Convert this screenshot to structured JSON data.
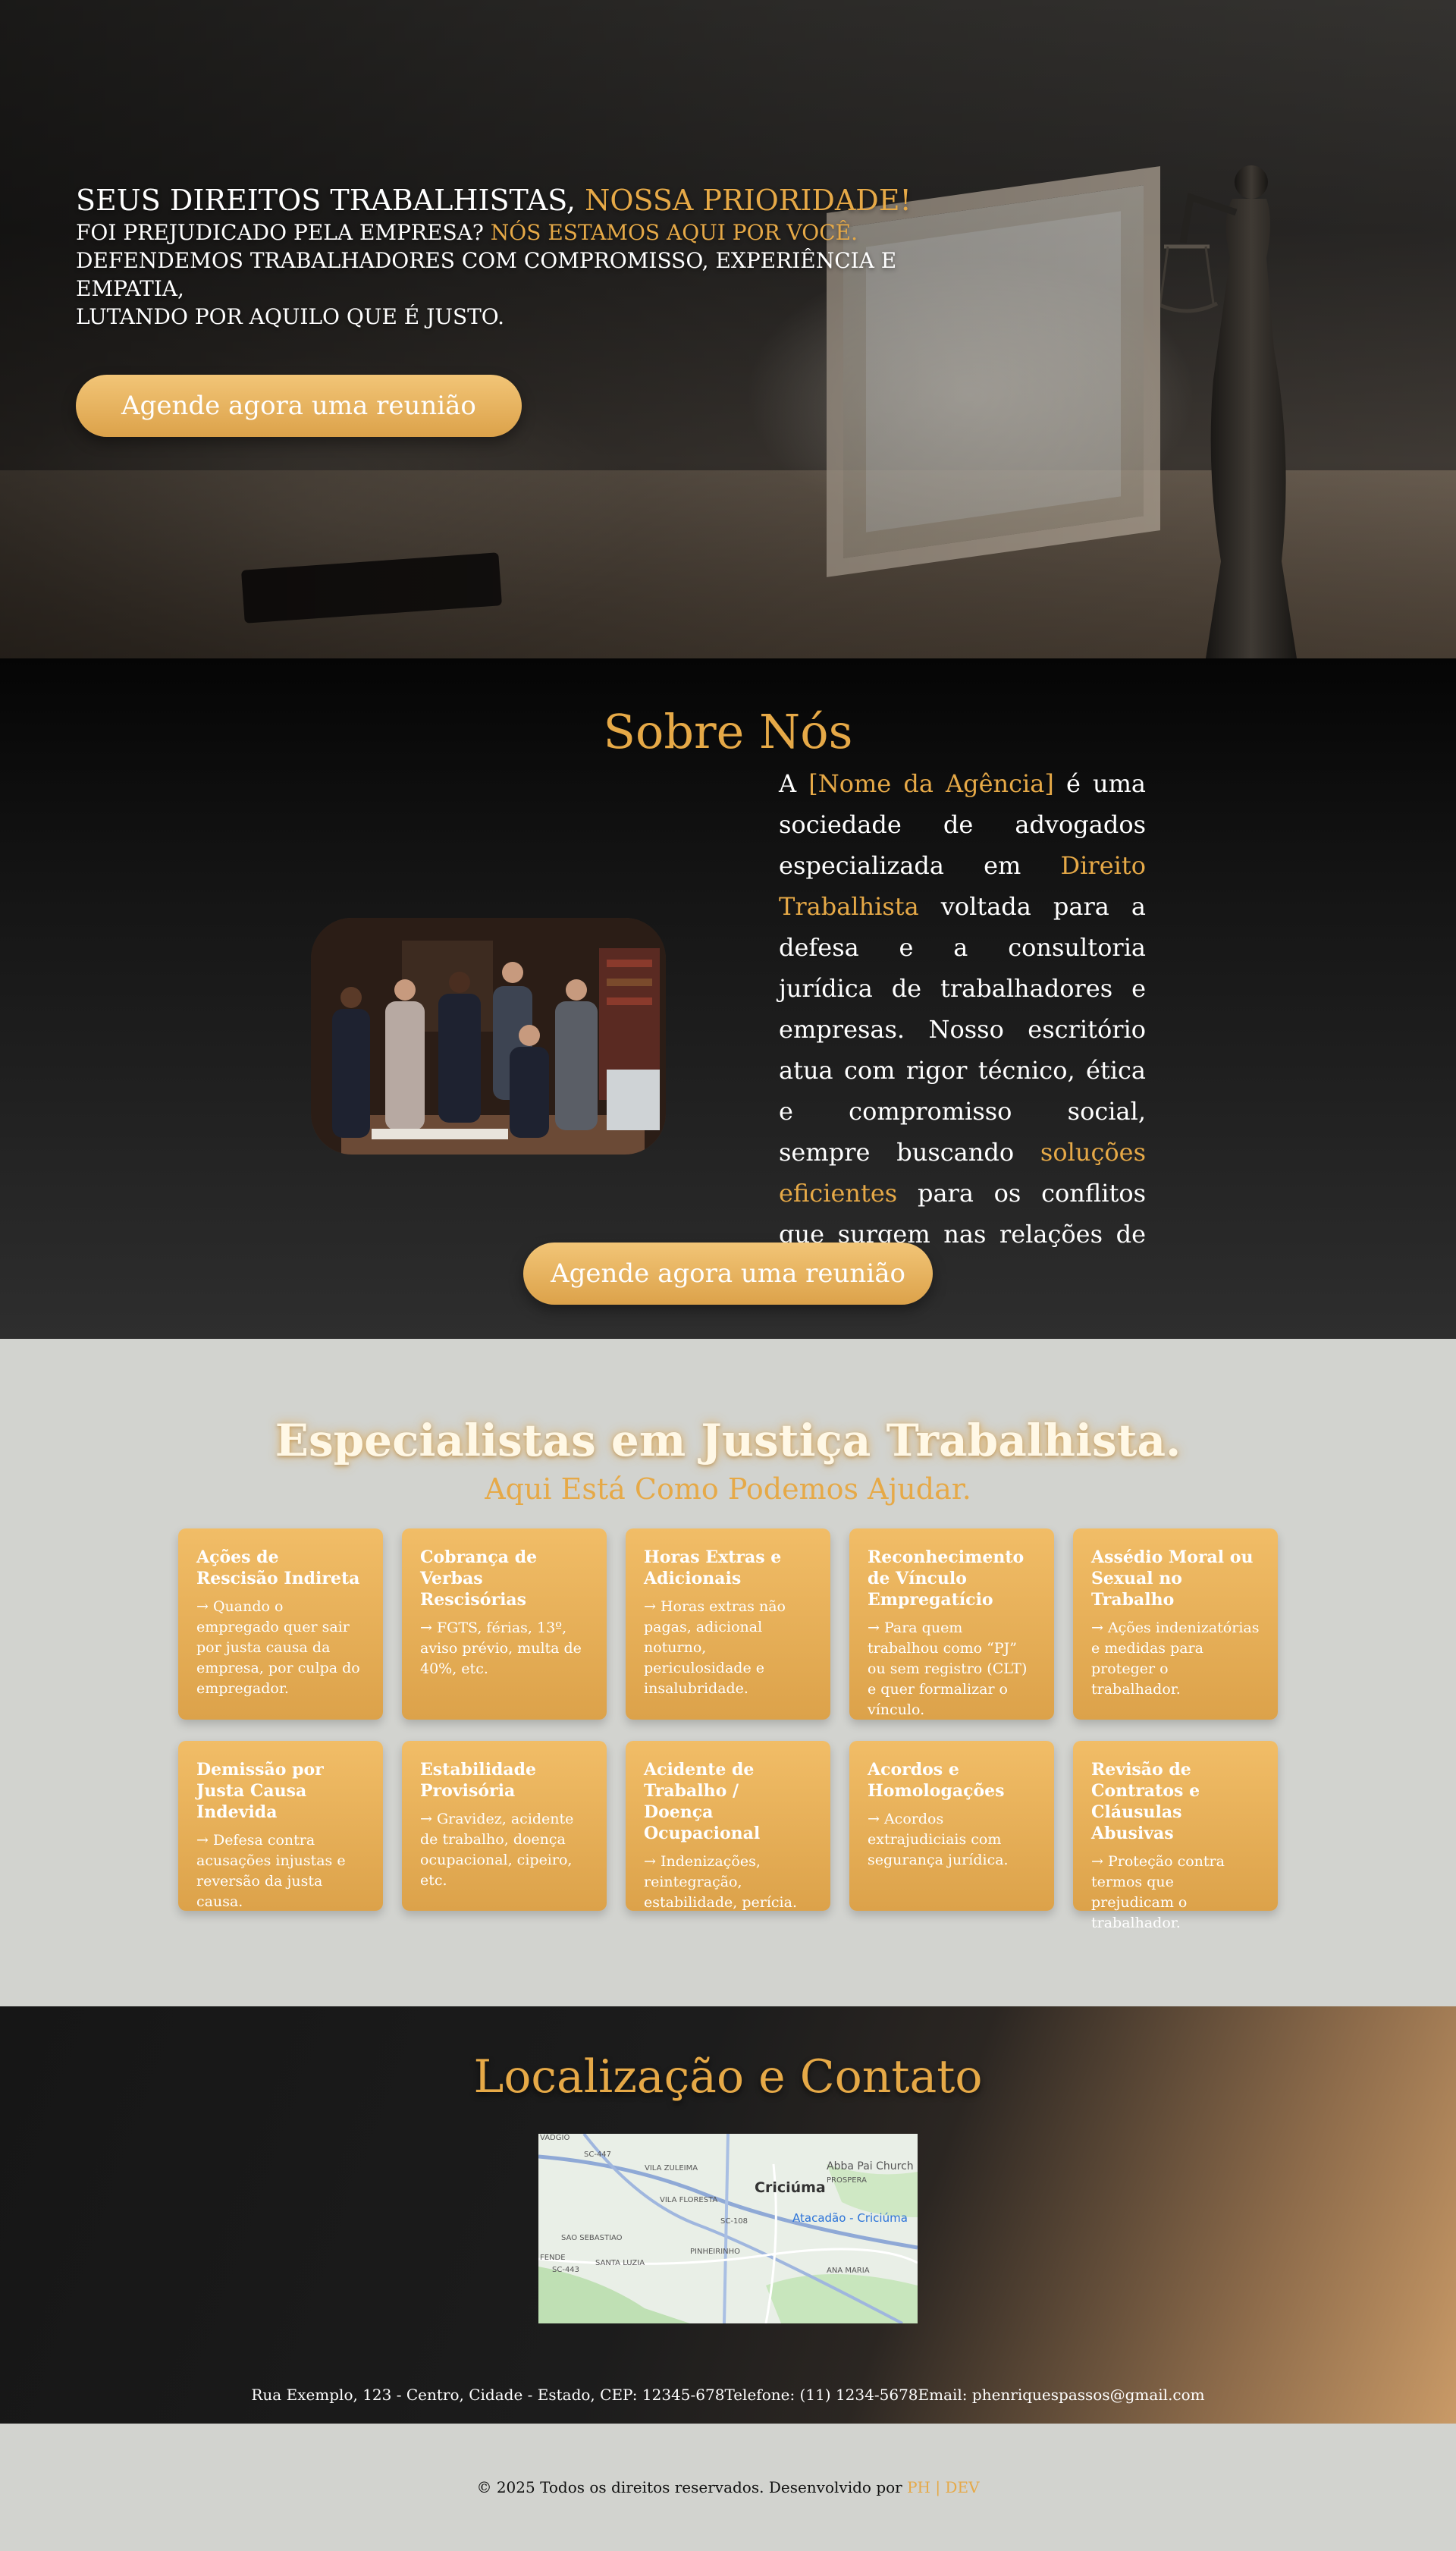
{
  "hero": {
    "title_white": "SEUS DIREITOS TRABALHISTAS,",
    "title_gold": "NOSSA PRIORIDADE!",
    "line1_white": "FOI PREJUDICADO PELA EMPRESA?",
    "line1_gold": "NÓS ESTAMOS AQUI POR VOCÊ.",
    "line2": "DEFENDEMOS TRABALHADORES COM COMPROMISSO, EXPERIÊNCIA E EMPATIA,",
    "line3_gold": "LUTANDO POR AQUILO QUE É JUSTO.",
    "cta_label": "Agende agora uma reunião"
  },
  "about": {
    "title": "Sobre Nós",
    "text_1": "A",
    "agency": "[Nome da Agência]",
    "text_2": "é uma sociedade de advogados especializada em",
    "area": "Direito Trabalhista",
    "text_3": "voltada para a defesa e a consultoria jurídica de trabalhadores e empresas. Nosso escritório atua com rigor técnico, ética e compromisso social, sempre buscando",
    "highlight": "soluções eficientes",
    "text_4": "para os conflitos que surgem nas relações de trabalho.",
    "cta_label": "Agende agora uma reunião"
  },
  "services": {
    "title": "Especialistas em Justiça Trabalhista.",
    "subtitle": "Aqui Está Como Podemos Ajudar.",
    "cards": [
      {
        "title": "Ações de Rescisão Indireta",
        "text": "→ Quando o empregado quer sair por justa causa da empresa, por culpa do empregador."
      },
      {
        "title": "Cobrança de Verbas Rescisórias",
        "text": "→ FGTS, férias, 13º, aviso prévio, multa de 40%, etc."
      },
      {
        "title": "Horas Extras e Adicionais",
        "text": "→ Horas extras não pagas, adicional noturno, periculosidade e insalubridade."
      },
      {
        "title": "Reconhecimento de Vínculo Empregatício",
        "text": "→ Para quem trabalhou como “PJ” ou sem registro (CLT) e quer formalizar o vínculo."
      },
      {
        "title": "Assédio Moral ou Sexual no Trabalho",
        "text": "→ Ações indenizatórias e medidas para proteger o trabalhador."
      },
      {
        "title": "Demissão por Justa Causa Indevida",
        "text": "→ Defesa contra acusações injustas e reversão da justa causa."
      },
      {
        "title": "Estabilidade Provisória",
        "text": "→ Gravidez, acidente de trabalho, doença ocupacional, cipeiro, etc."
      },
      {
        "title": "Acidente de Trabalho / Doença Ocupacional",
        "text": "→ Indenizações, reintegração, estabilidade, perícia."
      },
      {
        "title": "Acordos e Homologações",
        "text": "→ Acordos extrajudiciais com segurança jurídica."
      },
      {
        "title": "Revisão de Contratos e Cláusulas Abusivas",
        "text": "→ Proteção contra termos que prejudicam o trabalhador."
      }
    ]
  },
  "contact": {
    "title": "Localização e Contato",
    "map": {
      "city": "Criciúma",
      "poi": "Atacadão - Criciúma",
      "labels": [
        "VADGIO",
        "SC-447",
        "VILA ZULEIMA",
        "Abba Pai Church",
        "PROSPERA",
        "VILA FLORESTA",
        "SC-108",
        "SAO SEBASTIAO",
        "PINHEIRINHO",
        "FENDE",
        "SANTA LUZIA",
        "SC-443",
        "ANA MARIA"
      ]
    },
    "address": "Rua Exemplo, 123 - Centro, Cidade - Estado, CEP: 12345-678",
    "phone": "Telefone: (11) 1234-5678",
    "email": "Email: phenriquespassos@gmail.com"
  },
  "footer": {
    "copyright": "© 2025 Todos os direitos reservados. Desenvolvido por",
    "dev": "PH | DEV"
  },
  "colors": {
    "accent": "#e6a947",
    "card_top": "#f1bd67",
    "card_bottom": "#dca24a",
    "light_bg": "#d2d3cf"
  }
}
